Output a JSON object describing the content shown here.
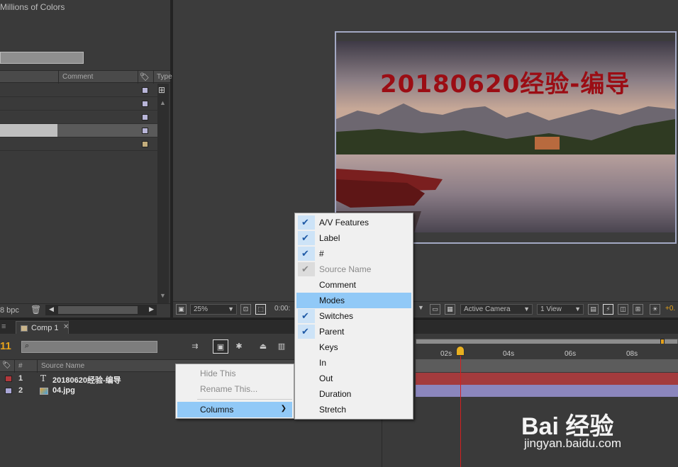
{
  "project_panel": {
    "info_text": "Millions of Colors",
    "columns": {
      "comment": "Comment",
      "type": "Type"
    },
    "rows": [
      {
        "label_color": "#b8b5d8"
      },
      {
        "label_color": "#b8b5d8"
      },
      {
        "label_color": "#b8b5d8"
      },
      {
        "label_color": "#b8b5d8",
        "selected": true
      },
      {
        "label_color": "#c3ad7c"
      }
    ],
    "bpc": "8 bpc"
  },
  "viewer": {
    "comp_text": "20180620经验-编导",
    "zoom": "25%",
    "timecode": "0:00:",
    "camera": "Active Camera",
    "views": "1 View",
    "exposure": "+0."
  },
  "timeline": {
    "tab_label": "Comp 1",
    "timecode": "11",
    "header": {
      "hash": "#",
      "source_name": "Source Name"
    },
    "layers": [
      {
        "num": "1",
        "name": "20180620经验-编导",
        "label_color": "#b2383c",
        "kind": "text"
      },
      {
        "num": "2",
        "name": "04.jpg",
        "label_color": "#a9a6d6",
        "kind": "image"
      }
    ],
    "ruler": [
      "02s",
      "04s",
      "06s",
      "08s"
    ]
  },
  "context_menu": {
    "items": [
      {
        "label": "Hide This",
        "disabled": true
      },
      {
        "label": "Rename This...",
        "disabled": true
      },
      {
        "label": "Columns",
        "submenu": true,
        "highlighted": true
      }
    ]
  },
  "columns_submenu": {
    "items": [
      {
        "label": "A/V Features",
        "checked": true
      },
      {
        "label": "Label",
        "checked": true
      },
      {
        "label": "#",
        "checked": true
      },
      {
        "label": "Source Name",
        "checked": true,
        "disabled": true
      },
      {
        "label": "Comment",
        "checked": false
      },
      {
        "label": "Modes",
        "checked": false,
        "highlighted": true
      },
      {
        "label": "Switches",
        "checked": true
      },
      {
        "label": "Parent",
        "checked": true
      },
      {
        "label": "Keys",
        "checked": false
      },
      {
        "label": "In",
        "checked": false
      },
      {
        "label": "Out",
        "checked": false
      },
      {
        "label": "Duration",
        "checked": false
      },
      {
        "label": "Stretch",
        "checked": false
      }
    ]
  },
  "watermark": {
    "brand": "Bai 经验",
    "url": "jingyan.baidu.com"
  }
}
